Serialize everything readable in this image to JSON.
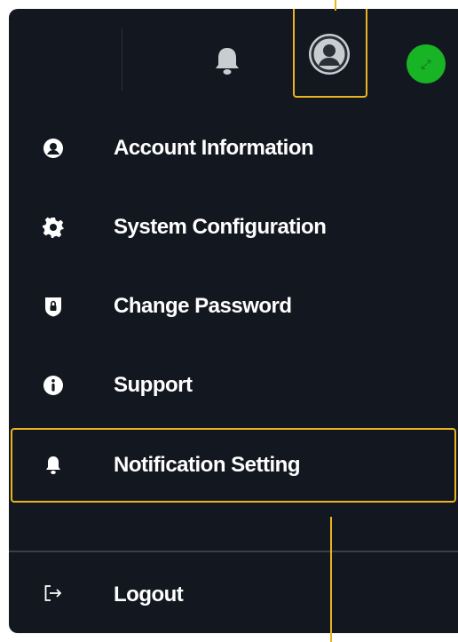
{
  "menu": {
    "items": [
      {
        "label": "Account Information",
        "icon": "account-circle-icon"
      },
      {
        "label": "System Configuration",
        "icon": "gear-icon"
      },
      {
        "label": "Change Password",
        "icon": "shield-lock-icon"
      },
      {
        "label": "Support",
        "icon": "info-icon"
      },
      {
        "label": "Notification Setting",
        "icon": "bell-icon"
      }
    ],
    "logout_label": "Logout",
    "logout_icon": "logout-arrow-icon"
  },
  "header": {
    "notification_icon": "bell-icon",
    "profile_icon": "user-avatar-icon",
    "status_icon": "status-indicator-icon"
  },
  "colors": {
    "panel_bg": "#131820",
    "highlight": "#e9b41f",
    "status_green": "#18b425",
    "text": "#ffffff"
  }
}
